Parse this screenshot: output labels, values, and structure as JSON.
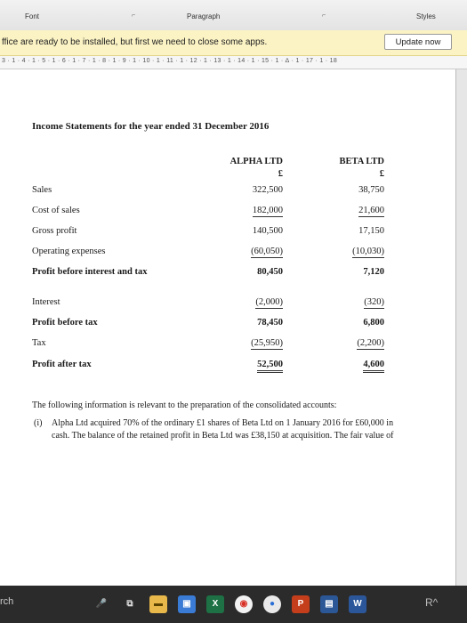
{
  "ribbon": {
    "font_label": "Font",
    "paragraph_label": "Paragraph",
    "styles_label": "Styles",
    "launcher_glyph": "⌐"
  },
  "info_bar": {
    "message": "ffice are ready to be installed, but first we need to close some apps.",
    "button_label": "Update now"
  },
  "ruler": {
    "text": "3 · 1 · 4 · 1 · 5 · 1 · 6 · 1 · 7 · 1 · 8 · 1 · 9 · 1 · 10 · 1 · 11 · 1 · 12 · 1 · 13 · 1 · 14 · 1 · 15 · 1 · ∆ · 1 · 17 · 1 · 18"
  },
  "document": {
    "heading": "Income Statements for the year ended 31 December 2016",
    "alpha_header": "ALPHA LTD",
    "beta_header": "BETA LTD",
    "currency": "£",
    "rows": [
      {
        "label": "Sales",
        "alpha": "322,500",
        "beta": "38,750"
      },
      {
        "label": "Cost of sales",
        "alpha": "182,000",
        "beta": "21,600"
      },
      {
        "label": "Gross profit",
        "alpha": "140,500",
        "beta": "17,150"
      },
      {
        "label": "Operating expenses",
        "alpha": "(60,050)",
        "beta": "(10,030)"
      },
      {
        "label": "Profit before interest and tax",
        "alpha": "80,450",
        "beta": "7,120"
      },
      {
        "label": "Interest",
        "alpha": "(2,000)",
        "beta": "(320)"
      },
      {
        "label": "Profit before tax",
        "alpha": "78,450",
        "beta": "6,800"
      },
      {
        "label": "Tax",
        "alpha": "(25,950)",
        "beta": "(2,200)"
      },
      {
        "label": "Profit after tax",
        "alpha": "52,500",
        "beta": "4,600"
      }
    ],
    "intro": "The following information is relevant to the preparation of the consolidated accounts:",
    "item_i_marker": "(i)",
    "item_i_line1": "Alpha Ltd acquired 70% of the ordinary £1 shares of Beta Ltd on 1 January 2016 for £60,000 in",
    "item_i_line2": "cash. The balance of the retained profit in Beta Ltd was £38,150 at acquisition. The fair value of"
  },
  "taskbar": {
    "search_text": "rch",
    "icons": [
      {
        "name": "mic",
        "glyph": "🎤"
      },
      {
        "name": "task-view",
        "glyph": "⧉"
      },
      {
        "name": "file-explorer",
        "glyph": "▬"
      },
      {
        "name": "store",
        "glyph": "▣"
      },
      {
        "name": "excel",
        "glyph": "X"
      },
      {
        "name": "chrome",
        "glyph": "◉"
      },
      {
        "name": "media",
        "glyph": "●"
      },
      {
        "name": "powerpoint",
        "glyph": "P"
      },
      {
        "name": "photos",
        "glyph": "▤"
      },
      {
        "name": "word",
        "glyph": "W"
      }
    ],
    "system_icon": "R^"
  }
}
